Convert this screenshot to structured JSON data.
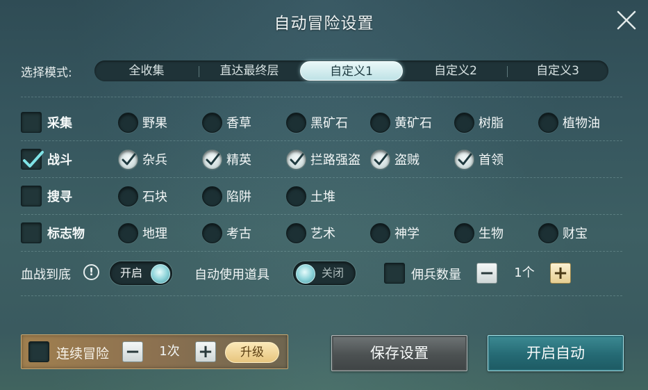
{
  "dialog": {
    "title": "自动冒险设置"
  },
  "mode": {
    "label": "选择模式:",
    "tabs": [
      {
        "label": "全收集",
        "active": false
      },
      {
        "label": "直达最终层",
        "active": false
      },
      {
        "label": "自定义1",
        "active": true
      },
      {
        "label": "自定义2",
        "active": false
      },
      {
        "label": "自定义3",
        "active": false
      }
    ]
  },
  "categories": [
    {
      "label": "采集",
      "checked": false,
      "options": [
        {
          "label": "野果",
          "checked": false
        },
        {
          "label": "香草",
          "checked": false
        },
        {
          "label": "黑矿石",
          "checked": false
        },
        {
          "label": "黄矿石",
          "checked": false
        },
        {
          "label": "树脂",
          "checked": false
        },
        {
          "label": "植物油",
          "checked": false
        }
      ]
    },
    {
      "label": "战斗",
      "checked": true,
      "options": [
        {
          "label": "杂兵",
          "checked": true
        },
        {
          "label": "精英",
          "checked": true
        },
        {
          "label": "拦路强盗",
          "checked": true
        },
        {
          "label": "盗贼",
          "checked": true
        },
        {
          "label": "首领",
          "checked": true
        }
      ]
    },
    {
      "label": "搜寻",
      "checked": false,
      "options": [
        {
          "label": "石块",
          "checked": false
        },
        {
          "label": "陷阱",
          "checked": false
        },
        {
          "label": "土堆",
          "checked": false
        }
      ]
    },
    {
      "label": "标志物",
      "checked": false,
      "options": [
        {
          "label": "地理",
          "checked": false
        },
        {
          "label": "考古",
          "checked": false
        },
        {
          "label": "艺术",
          "checked": false
        },
        {
          "label": "神学",
          "checked": false
        },
        {
          "label": "生物",
          "checked": false
        },
        {
          "label": "财宝",
          "checked": false
        }
      ]
    }
  ],
  "settings": {
    "blood_label": "血战到底",
    "info_icon": "!",
    "blood_toggle": {
      "text": "开启",
      "on": true
    },
    "tool_label": "自动使用道具",
    "tool_toggle": {
      "text": "关闭",
      "on": false
    },
    "merc_checked": false,
    "merc_label": "佣兵数量",
    "merc_value": "1个",
    "minus": "−",
    "plus": "+"
  },
  "continuous": {
    "checked": false,
    "label": "连续冒险",
    "value": "1次",
    "upgrade_label": "升级"
  },
  "buttons": {
    "save_label": "保存设置",
    "start_label": "开启自动"
  },
  "colors": {
    "accent_teal": "#8fd4da",
    "gold": "#e7c57e"
  }
}
